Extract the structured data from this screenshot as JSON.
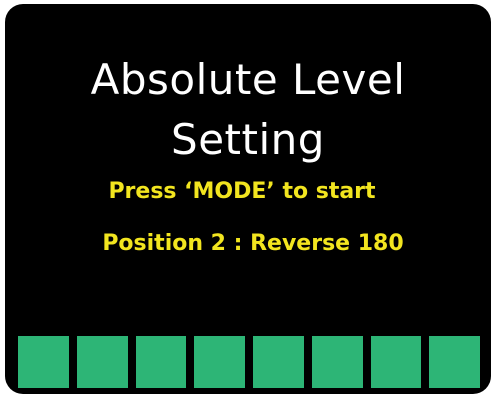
{
  "screen": {
    "title_line1": "Absolute Level",
    "title_line2": "Setting",
    "instruction": "Press ‘MODE’ to start",
    "position_text": "Position 2 : Reverse 180"
  },
  "progress": {
    "segments_total": 8,
    "segments_filled": 8,
    "fill_color": "#2db576"
  },
  "colors": {
    "background": "#000000",
    "title": "#ffffff",
    "hint": "#f2e51f"
  }
}
